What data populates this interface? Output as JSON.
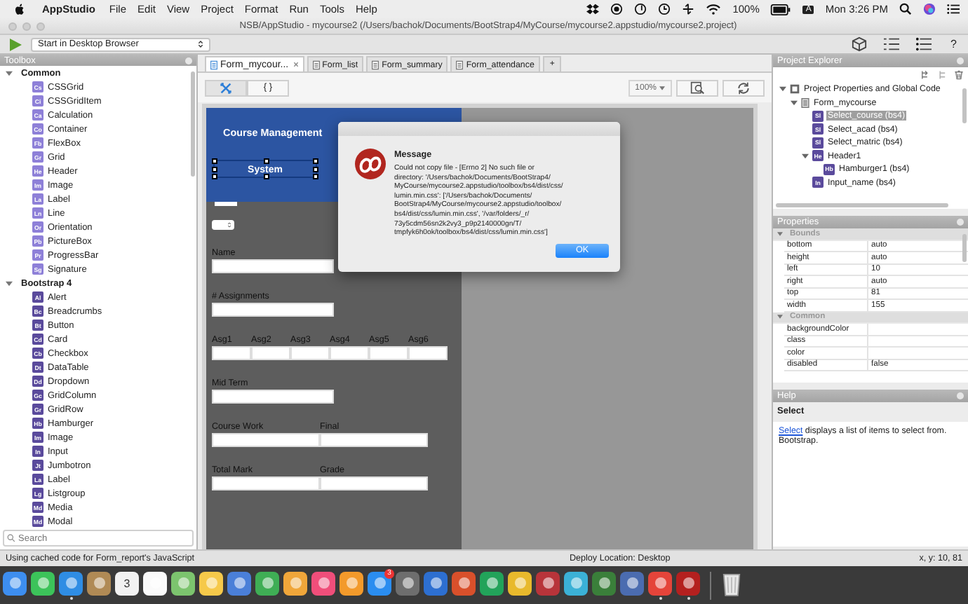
{
  "menubar": {
    "app": "AppStudio",
    "menus": [
      "File",
      "Edit",
      "View",
      "Project",
      "Format",
      "Run",
      "Tools",
      "Help"
    ],
    "battery": "100%",
    "input_source": "A",
    "clock": "Mon 3:26 PM"
  },
  "window": {
    "title": "NSB/AppStudio - mycourse2 (/Users/bachok/Documents/BootStrap4/MyCourse/mycourse2.appstudio/mycourse2.project)"
  },
  "toolbar": {
    "run_target": "Start in Desktop Browser",
    "help": "?"
  },
  "toolbox": {
    "title": "Toolbox",
    "search_placeholder": "Search",
    "groups": [
      {
        "name": "Common",
        "expanded": true,
        "color": "#8e80d8",
        "items": [
          {
            "badge": "Cs",
            "label": "CSSGrid"
          },
          {
            "badge": "Ci",
            "label": "CSSGridItem"
          },
          {
            "badge": "Ca",
            "label": "Calculation"
          },
          {
            "badge": "Co",
            "label": "Container"
          },
          {
            "badge": "Fb",
            "label": "FlexBox"
          },
          {
            "badge": "Gr",
            "label": "Grid"
          },
          {
            "badge": "He",
            "label": "Header"
          },
          {
            "badge": "Im",
            "label": "Image"
          },
          {
            "badge": "La",
            "label": "Label"
          },
          {
            "badge": "Ln",
            "label": "Line"
          },
          {
            "badge": "Or",
            "label": "Orientation"
          },
          {
            "badge": "Pb",
            "label": "PictureBox"
          },
          {
            "badge": "Pr",
            "label": "ProgressBar"
          },
          {
            "badge": "Sg",
            "label": "Signature"
          }
        ]
      },
      {
        "name": "Bootstrap 4",
        "expanded": true,
        "color": "#5a4a9c",
        "items": [
          {
            "badge": "Al",
            "label": "Alert"
          },
          {
            "badge": "Bc",
            "label": "Breadcrumbs"
          },
          {
            "badge": "Bt",
            "label": "Button"
          },
          {
            "badge": "Cd",
            "label": "Card"
          },
          {
            "badge": "Cb",
            "label": "Checkbox"
          },
          {
            "badge": "Dt",
            "label": "DataTable"
          },
          {
            "badge": "Dd",
            "label": "Dropdown"
          },
          {
            "badge": "Gc",
            "label": "GridColumn"
          },
          {
            "badge": "Gr",
            "label": "GridRow"
          },
          {
            "badge": "Hb",
            "label": "Hamburger"
          },
          {
            "badge": "Im",
            "label": "Image"
          },
          {
            "badge": "In",
            "label": "Input"
          },
          {
            "badge": "Jt",
            "label": "Jumbotron"
          },
          {
            "badge": "La",
            "label": "Label"
          },
          {
            "badge": "Lg",
            "label": "Listgroup"
          },
          {
            "badge": "Md",
            "label": "Media"
          },
          {
            "badge": "Md",
            "label": "Modal"
          }
        ]
      }
    ]
  },
  "tabs": [
    {
      "label": "Form_mycour...",
      "selected": true,
      "closable": true
    },
    {
      "label": "Form_list",
      "selected": false,
      "closable": false
    },
    {
      "label": "Form_summary",
      "selected": false,
      "closable": false
    },
    {
      "label": "Form_attendance",
      "selected": false,
      "closable": false
    }
  ],
  "new_tab": "+",
  "view_buttons": [
    {
      "kind": "design",
      "selected": true
    },
    {
      "kind": "code",
      "label": "{ }",
      "selected": false
    }
  ],
  "zoom": "100%",
  "design": {
    "header": {
      "title": "Course Management",
      "subtitle": "System",
      "subtitle_selected": true
    },
    "rows": [
      {
        "kind": "stub"
      },
      {
        "kind": "stepper"
      },
      {
        "kind": "single",
        "labels": [
          "Name"
        ]
      },
      {
        "kind": "single",
        "labels": [
          "# Assignments"
        ]
      },
      {
        "kind": "sextet",
        "labels": [
          "Asg1",
          "Asg2",
          "Asg3",
          "Asg4",
          "Asg5",
          "Asg6"
        ]
      },
      {
        "kind": "single",
        "labels": [
          "Mid Term"
        ]
      },
      {
        "kind": "pair",
        "labels": [
          "Course Work",
          "Final"
        ]
      },
      {
        "kind": "pair",
        "labels": [
          "Total Mark",
          "Grade"
        ]
      }
    ]
  },
  "dialog": {
    "title": "Message",
    "message": "Could not copy file - [Errno 2] No such file or\ndirectory: '/Users/bachok/Documents/BootStrap4/\nMyCourse/mycourse2.appstudio/toolbox/bs4/dist/css/\nlumin.min.css': ['/Users/bachok/Documents/\nBootStrap4/MyCourse/mycourse2.appstudio/toolbox/\nbs4/dist/css/lumin.min.css', '/var/folders/_r/\n73y5cdm56sn2k2vy3_p9p2140000gn/T/\ntmpfyk6h0ok/toolbox/bs4/dist/css/lumin.min.css']",
    "button": "OK"
  },
  "explorer": {
    "title": "Project Explorer",
    "tree": [
      {
        "kind": "project",
        "label": "Project Properties and Global Code",
        "selected": false,
        "expanded": true,
        "children": [
          {
            "kind": "form",
            "label": "Form_mycourse",
            "selected": false,
            "expanded": true,
            "children": [
              {
                "kind": "control",
                "badge": "Sl",
                "label": "Select_course (bs4)",
                "selected": true
              },
              {
                "kind": "control",
                "badge": "Sl",
                "label": "Select_acad (bs4)",
                "selected": false
              },
              {
                "kind": "control",
                "badge": "Sl",
                "label": "Select_matric (bs4)",
                "selected": false
              },
              {
                "kind": "control",
                "badge": "He",
                "label": "Header1",
                "selected": false,
                "expanded": true,
                "children": [
                  {
                    "kind": "control",
                    "badge": "Hb",
                    "label": "Hamburger1 (bs4)",
                    "selected": false
                  }
                ]
              },
              {
                "kind": "control",
                "badge": "In",
                "label": "Input_name (bs4)",
                "selected": false
              }
            ]
          }
        ]
      }
    ]
  },
  "properties": {
    "title": "Properties",
    "groups": [
      {
        "name": "Bounds",
        "expanded": true,
        "rows": [
          {
            "name": "bottom",
            "value": "auto"
          },
          {
            "name": "height",
            "value": "auto"
          },
          {
            "name": "left",
            "value": "10"
          },
          {
            "name": "right",
            "value": "auto"
          },
          {
            "name": "top",
            "value": "81"
          },
          {
            "name": "width",
            "value": "155"
          }
        ]
      },
      {
        "name": "Common",
        "expanded": true,
        "rows": [
          {
            "name": "backgroundColor"
          },
          {
            "name": "class"
          },
          {
            "name": "color"
          },
          {
            "name": "disabled",
            "value": "false"
          }
        ]
      }
    ]
  },
  "help": {
    "title": "Help",
    "heading": "Select",
    "link": "Select",
    "text": "displays a list of items to select from. Bootstrap."
  },
  "status_bar": {
    "left": "Using cached code for Form_report's JavaScript",
    "center": "Deploy Location: Desktop",
    "right": "x, y: 10, 81"
  },
  "dock": [
    {
      "color": "#3d8ef0",
      "running": false
    },
    {
      "color": "#3cc35a",
      "running": false
    },
    {
      "color": "#2f8de4",
      "running": true
    },
    {
      "color": "#b08a55",
      "running": false
    },
    {
      "color": "#f2f2f2",
      "running": false,
      "date": "3"
    },
    {
      "color": "#fafafa",
      "running": false
    },
    {
      "color": "#7cc46e",
      "running": false
    },
    {
      "color": "#f6c94a",
      "running": false
    },
    {
      "color": "#4a7fd8",
      "running": false
    },
    {
      "color": "#3fae55",
      "running": false
    },
    {
      "color": "#f0a63a",
      "running": false
    },
    {
      "color": "#f04e7a",
      "running": false
    },
    {
      "color": "#f39a2b",
      "running": false
    },
    {
      "color": "#2a8df0",
      "running": false,
      "badge": "3"
    },
    {
      "color": "#6e6e6e",
      "running": false
    },
    {
      "color": "#2d6fd1",
      "running": false
    },
    {
      "color": "#d9502b",
      "running": false
    },
    {
      "color": "#22a35a",
      "running": false
    },
    {
      "color": "#e8b92c",
      "running": false
    },
    {
      "color": "#b8343a",
      "running": false
    },
    {
      "color": "#3bb1d6",
      "running": false
    },
    {
      "color": "#3a7f3a",
      "running": false
    },
    {
      "color": "#4b6cb0",
      "running": false
    },
    {
      "color": "#e5443a",
      "running": true
    },
    {
      "color": "#b4201f",
      "running": true
    }
  ]
}
